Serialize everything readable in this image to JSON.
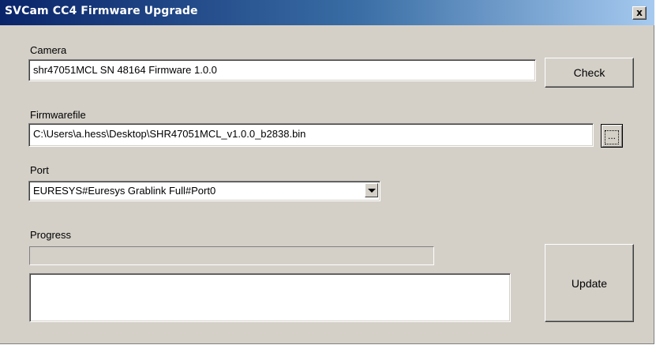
{
  "window": {
    "title": "SVCam CC4 Firmware Upgrade",
    "close_glyph": "x"
  },
  "camera": {
    "label": "Camera",
    "value": "shr47051MCL SN 48164 Firmware 1.0.0",
    "check_button": "Check"
  },
  "firmware": {
    "label": "Firmwarefile",
    "value": "C:\\Users\\a.hess\\Desktop\\SHR47051MCL_v1.0.0_b2838.bin",
    "browse_button": "..."
  },
  "port": {
    "label": "Port",
    "selected": "EURESYS#Euresys Grablink Full#Port0"
  },
  "progress": {
    "label": "Progress",
    "fraction": 0
  },
  "log": {
    "text": ""
  },
  "update_button": "Update",
  "icons": {
    "close": "close-icon",
    "dropdown": "chevron-down-icon"
  }
}
